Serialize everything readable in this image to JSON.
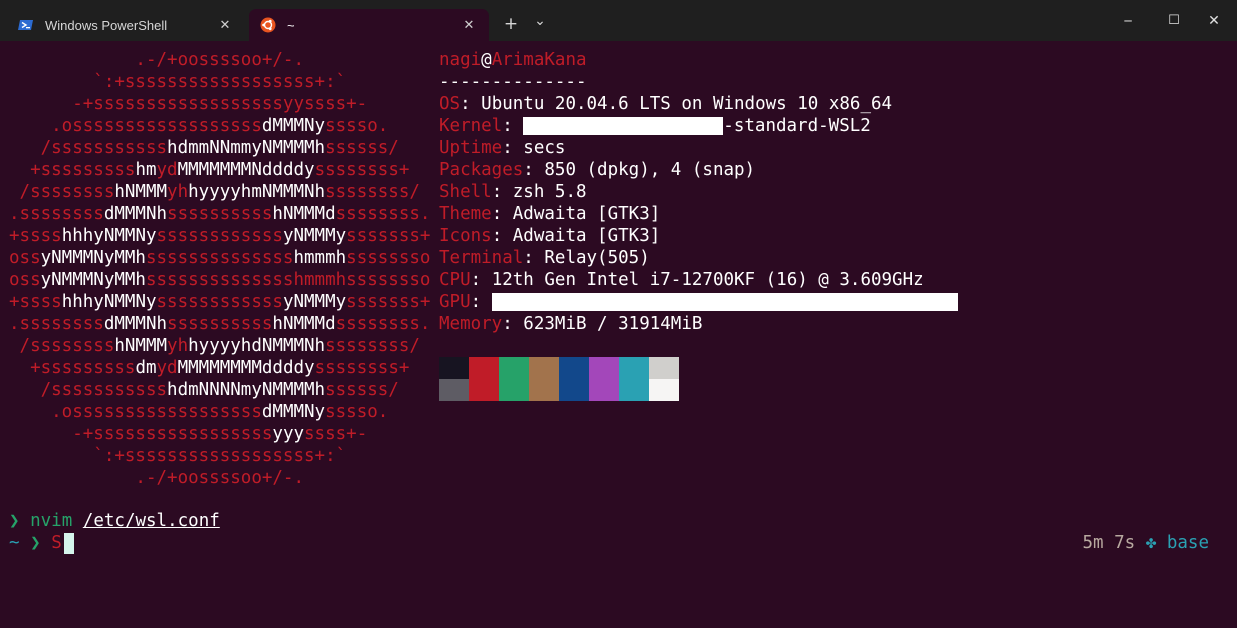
{
  "tabs": [
    {
      "label": "Windows PowerShell",
      "icon": "powershell-icon"
    },
    {
      "label": "~",
      "icon": "ubuntu-icon"
    }
  ],
  "buttons": {
    "close_tab": "✕",
    "new_tab": "+",
    "dropdown": "⌄",
    "minimize": "─",
    "maximize": "☐",
    "close": "✕"
  },
  "neofetch": {
    "ascii": [
      [
        [
          "r",
          "            .-/+oossssoo+/-."
        ]
      ],
      [
        [
          "r",
          "        `:+ssssssssssssssssss+:`"
        ]
      ],
      [
        [
          "r",
          "      -+ssssssssssssssssssyyssss+-"
        ]
      ],
      [
        [
          "r",
          "    .ossssssssssssssssss"
        ],
        [
          "w",
          "dMMMNy"
        ],
        [
          "r",
          "sssso."
        ]
      ],
      [
        [
          "r",
          "   /sssssssssss"
        ],
        [
          "w",
          "hdmmNNmmyNMMMMh"
        ],
        [
          "r",
          "ssssss/"
        ]
      ],
      [
        [
          "r",
          "  +sssssssss"
        ],
        [
          "w",
          "hm"
        ],
        [
          "r",
          "yd"
        ],
        [
          "w",
          "MMMMMMMNddddy"
        ],
        [
          "r",
          "ssssssss+"
        ]
      ],
      [
        [
          "r",
          " /ssssssss"
        ],
        [
          "w",
          "hNMMM"
        ],
        [
          "r",
          "yh"
        ],
        [
          "w",
          "hyyyyhmNMMMNh"
        ],
        [
          "r",
          "ssssssss/"
        ]
      ],
      [
        [
          "r",
          ".ssssssss"
        ],
        [
          "w",
          "dMMMNh"
        ],
        [
          "r",
          "ssssssssss"
        ],
        [
          "w",
          "hNMMMd"
        ],
        [
          "r",
          "ssssssss."
        ]
      ],
      [
        [
          "r",
          "+ssss"
        ],
        [
          "w",
          "hhhyNMMNy"
        ],
        [
          "r",
          "ssssssssssss"
        ],
        [
          "w",
          "yNMMMy"
        ],
        [
          "r",
          "sssssss+"
        ]
      ],
      [
        [
          "r",
          "oss"
        ],
        [
          "w",
          "yNMMMNyMMh"
        ],
        [
          "r",
          "ssssssssssssss"
        ],
        [
          "w",
          "hmmmh"
        ],
        [
          "r",
          "ssssssso"
        ]
      ],
      [
        [
          "r",
          "oss"
        ],
        [
          "w",
          "yNMMMNyMMh"
        ],
        [
          "r",
          "sssssssssssssshmmmhssssssso"
        ]
      ],
      [
        [
          "r",
          "+ssss"
        ],
        [
          "w",
          "hhhyNMMNy"
        ],
        [
          "r",
          "ssssssssssss"
        ],
        [
          "w",
          "yNMMMy"
        ],
        [
          "r",
          "sssssss+"
        ]
      ],
      [
        [
          "r",
          ".ssssssss"
        ],
        [
          "w",
          "dMMMNh"
        ],
        [
          "r",
          "ssssssssss"
        ],
        [
          "w",
          "hNMMMd"
        ],
        [
          "r",
          "ssssssss."
        ]
      ],
      [
        [
          "r",
          " /ssssssss"
        ],
        [
          "w",
          "hNMMM"
        ],
        [
          "r",
          "yh"
        ],
        [
          "w",
          "hyyyyhdNMMMNh"
        ],
        [
          "r",
          "ssssssss/"
        ]
      ],
      [
        [
          "r",
          "  +sssssssss"
        ],
        [
          "w",
          "dm"
        ],
        [
          "r",
          "yd"
        ],
        [
          "w",
          "MMMMMMMMddddy"
        ],
        [
          "r",
          "ssssssss+"
        ]
      ],
      [
        [
          "r",
          "   /sssssssssss"
        ],
        [
          "w",
          "hdmNNNNmyNMMMMh"
        ],
        [
          "r",
          "ssssss/"
        ]
      ],
      [
        [
          "r",
          "    .ossssssssssssssssss"
        ],
        [
          "w",
          "dMMMNy"
        ],
        [
          "r",
          "sssso."
        ]
      ],
      [
        [
          "r",
          "      -+sssssssssssssssss"
        ],
        [
          "w",
          "yyy"
        ],
        [
          "r",
          "ssss+-"
        ]
      ],
      [
        [
          "r",
          "        `:+ssssssssssssssssss+:`"
        ]
      ],
      [
        [
          "r",
          "            .-/+oossssoo+/-."
        ]
      ]
    ],
    "user": "nagi",
    "at": "@",
    "host": "ArimaKana",
    "separator": "--------------",
    "fields": [
      {
        "key": "OS",
        "value": "Ubuntu 20.04.6 LTS on Windows 10 x86_64"
      },
      {
        "key": "Kernel",
        "value": "-standard-WSL2",
        "redacted": true
      },
      {
        "key": "Uptime",
        "value": "secs"
      },
      {
        "key": "Packages",
        "value": "850 (dpkg), 4 (snap)"
      },
      {
        "key": "Shell",
        "value": "zsh 5.8"
      },
      {
        "key": "Theme",
        "value": "Adwaita [GTK3]"
      },
      {
        "key": "Icons",
        "value": "Adwaita [GTK3]"
      },
      {
        "key": "Terminal",
        "value": "Relay(505)"
      },
      {
        "key": "CPU",
        "value": "12th Gen Intel i7-12700KF (16) @ 3.609GHz"
      },
      {
        "key": "GPU",
        "value": "",
        "redacted": true
      },
      {
        "key": "Memory",
        "value": "623MiB / 31914MiB"
      }
    ],
    "palette": [
      "#171421",
      "#c01c28",
      "#26a269",
      "#a2734c",
      "#12488b",
      "#a347ba",
      "#2aa1b3",
      "#d0cfcc",
      "#5e5c64",
      "#c01c28",
      "#26a269",
      "#a2734c",
      "#12488b",
      "#a347ba",
      "#2aa1b3",
      "#f6f5f4"
    ]
  },
  "history": {
    "prompt_symbol": "❯",
    "command": "nvim",
    "arg": "/etc/wsl.conf"
  },
  "current": {
    "cwd": "~",
    "prompt_symbol": "❯",
    "input": "S"
  },
  "right_prompt": {
    "duration": "5m 7s",
    "env_icon": "✤",
    "env": "base"
  }
}
